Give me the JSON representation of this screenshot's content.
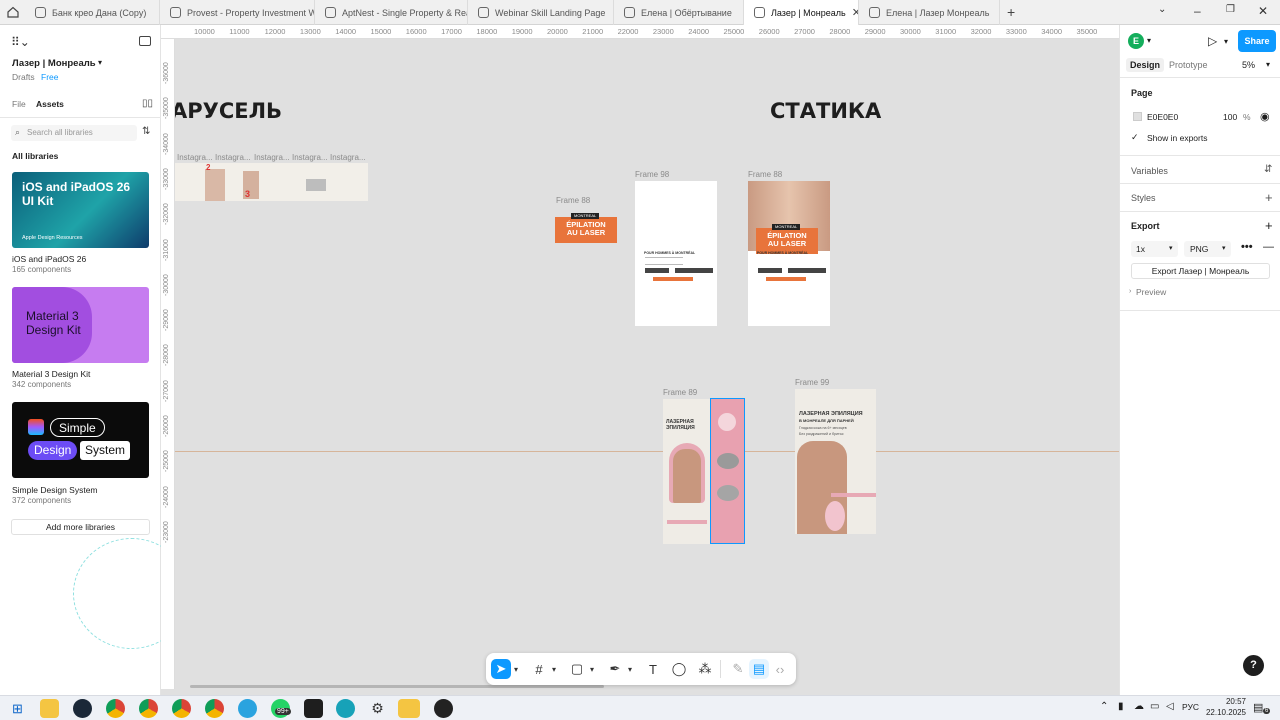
{
  "tabs": [
    {
      "title": "Банк крео Дана (Copy)",
      "active": false
    },
    {
      "title": "Provest - Property Investment Wel",
      "active": false
    },
    {
      "title": "AptNest - Single Property & Real E",
      "active": false
    },
    {
      "title": "Webinar Skill Landing Page",
      "active": false
    },
    {
      "title": "Елена | Обёртывание",
      "active": false
    },
    {
      "title": "Лазер | Монреаль",
      "active": true
    },
    {
      "title": "Елена | Лазер Монреаль",
      "active": false
    }
  ],
  "left_panel": {
    "file_name": "Лазер | Монреаль",
    "drafts": "Drafts",
    "plan": "Free",
    "tab_file": "File",
    "tab_assets": "Assets",
    "search_placeholder": "Search all libraries",
    "all_libraries": "All libraries",
    "libraries": [
      {
        "title_line1": "iOS and iPadOS 26",
        "title_line2": "UI Kit",
        "badge": "Apple Design Resources",
        "name": "iOS and iPadOS 26",
        "count": "165 components"
      },
      {
        "title_line1": "Material 3",
        "title_line2": "Design Kit",
        "name": "Material 3 Design Kit",
        "count": "342 components"
      },
      {
        "word1": "Simple",
        "word2": "Design",
        "word3": "System",
        "name": "Simple Design System",
        "count": "372 components"
      }
    ],
    "add_more": "Add more libraries"
  },
  "ruler_top": [
    "10000",
    "11000",
    "12000",
    "13000",
    "14000",
    "15000",
    "16000",
    "17000",
    "18000",
    "19000",
    "20000",
    "21000",
    "22000",
    "23000",
    "24000",
    "25000",
    "26000",
    "27000",
    "28000",
    "29000",
    "30000",
    "31000",
    "32000",
    "33000",
    "34000",
    "35000"
  ],
  "ruler_left": [
    "-36000",
    "-35000",
    "-34000",
    "-33000",
    "-32000",
    "-31000",
    "-30000",
    "-29000",
    "-28000",
    "-27000",
    "-26000",
    "-25000",
    "-24000",
    "-23000"
  ],
  "canvas": {
    "heading_carousel": "АРУСЕЛЬ",
    "heading_static": "СТАТИКА",
    "insta_labels": [
      "Instagra...",
      "Instagra...",
      "Instagra...",
      "Instagra...",
      "Instagra..."
    ],
    "frames": [
      {
        "label": "Frame 88",
        "tag": "MONTREAL",
        "line1": "ÉPILATION",
        "line2": "AU LASER"
      },
      {
        "label": "Frame 98",
        "caption": "POUR HOMMES À MONTRÉAL"
      },
      {
        "label": "Frame 88",
        "tag": "MONTREAL",
        "line1": "ÉPILATION",
        "line2": "AU LASER",
        "caption": "POUR HOMMES À MONTRÉAL"
      },
      {
        "label": "Frame 89",
        "title": "ЛАЗЕРНАЯ ЭПИЛЯЦИЯ"
      },
      {
        "label": "Frame 99",
        "title": "ЛАЗЕРНАЯ ЭПИЛЯЦИЯ",
        "subtitle": "В МОНРЕАЛЕ ДЛЯ ПАРНЕЙ",
        "body1": "Гладкая кожа на 6+ месяцев",
        "body2": "Без раздражений и бритья"
      }
    ]
  },
  "right_panel": {
    "avatar": "E",
    "share": "Share",
    "tab_design": "Design",
    "tab_prototype": "Prototype",
    "zoom": "5%",
    "page_title": "Page",
    "page_color": "E0E0E0",
    "page_opacity": "100",
    "percent": "%",
    "show_in_exports": "Show in exports",
    "variables": "Variables",
    "styles": "Styles",
    "export": "Export",
    "scale": "1x",
    "format": "PNG",
    "export_button": "Export Лазер | Монреаль",
    "preview": "Preview"
  },
  "taskbar": {
    "lang": "РУС",
    "time": "20:57",
    "date": "22.10.2025",
    "badge": "99+",
    "notif": "6"
  },
  "colors": {
    "accent": "#0d99ff",
    "canvas": "#e0e0e0",
    "orange": "#e8743b",
    "pink": "#e8a1b0"
  }
}
